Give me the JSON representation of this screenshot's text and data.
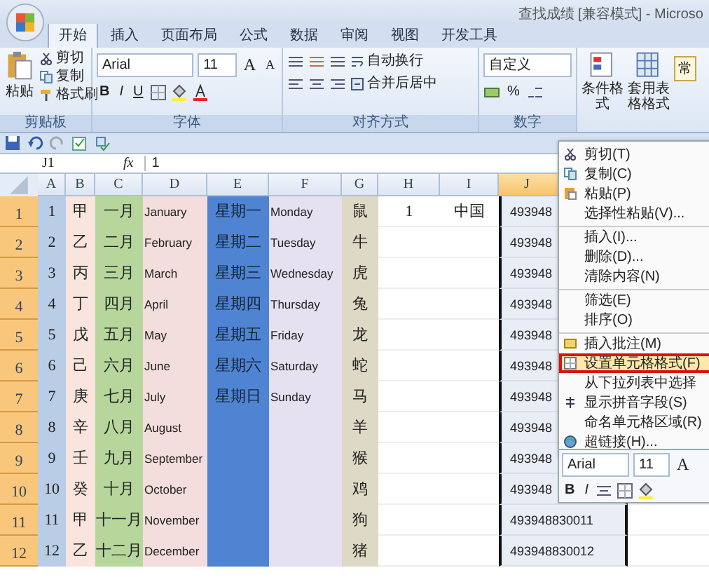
{
  "window": {
    "title": "查找成绩 [兼容模式] - Microso"
  },
  "ribbon_tabs": [
    {
      "label": "开始",
      "selected": true
    },
    {
      "label": "插入",
      "selected": false
    },
    {
      "label": "页面布局",
      "selected": false
    },
    {
      "label": "公式",
      "selected": false
    },
    {
      "label": "数据",
      "selected": false
    },
    {
      "label": "审阅",
      "selected": false
    },
    {
      "label": "视图",
      "selected": false
    },
    {
      "label": "开发工具",
      "selected": false
    }
  ],
  "clipboard": {
    "group": "剪贴板",
    "paste": "粘贴",
    "cut": "剪切",
    "copy": "复制",
    "format_painter": "格式刷"
  },
  "font": {
    "group": "字体",
    "family": "Arial",
    "size": "11",
    "grow": "A",
    "shrink": "A",
    "bold": "B",
    "italic": "I",
    "underline": "U"
  },
  "alignment": {
    "group": "对齐方式",
    "wrap": "自动换行",
    "merge": "合并后居中"
  },
  "number": {
    "group": "数字",
    "format": "自定义",
    "percent": "%"
  },
  "styles": {
    "conditional": "条件格式",
    "table": "套用表格格式",
    "cell_style": "常"
  },
  "formula_bar": {
    "name_box": "J1",
    "function_label": "fx",
    "value": "1"
  },
  "sheet": {
    "columns": [
      {
        "label": "A",
        "color": "#b9cde6",
        "selected": false
      },
      {
        "label": "B",
        "color": "#f9e5dd",
        "selected": false
      },
      {
        "label": "C",
        "color": "#b6d69c",
        "selected": false
      },
      {
        "label": "D",
        "color": "#f3dedd",
        "selected": false
      },
      {
        "label": "E",
        "color": "#4f84d2",
        "selected": false
      },
      {
        "label": "F",
        "color": "#e6e1f1",
        "selected": false
      },
      {
        "label": "G",
        "color": "#ddd9c4",
        "selected": false
      },
      {
        "label": "H",
        "color": "#ffffff",
        "selected": false
      },
      {
        "label": "I",
        "color": "#ffffff",
        "selected": false
      },
      {
        "label": "J",
        "color": "#e9edf5",
        "selected": true
      }
    ],
    "rows": [
      {
        "label": "1",
        "selected": true,
        "cells": [
          "1",
          "甲",
          "一月",
          "January",
          "星期一",
          "Monday",
          "鼠",
          "1",
          "中国",
          "493948"
        ]
      },
      {
        "label": "2",
        "selected": true,
        "cells": [
          "2",
          "乙",
          "二月",
          "February",
          "星期二",
          "Tuesday",
          "牛",
          null,
          null,
          "493948"
        ]
      },
      {
        "label": "3",
        "selected": true,
        "cells": [
          "3",
          "丙",
          "三月",
          "March",
          "星期三",
          "Wednesday",
          "虎",
          null,
          null,
          "493948"
        ]
      },
      {
        "label": "4",
        "selected": true,
        "cells": [
          "4",
          "丁",
          "四月",
          "April",
          "星期四",
          "Thursday",
          "兔",
          null,
          null,
          "493948"
        ]
      },
      {
        "label": "5",
        "selected": true,
        "cells": [
          "5",
          "戊",
          "五月",
          "May",
          "星期五",
          "Friday",
          "龙",
          null,
          null,
          "493948"
        ]
      },
      {
        "label": "6",
        "selected": true,
        "cells": [
          "6",
          "己",
          "六月",
          "June",
          "星期六",
          "Saturday",
          "蛇",
          null,
          null,
          "493948"
        ]
      },
      {
        "label": "7",
        "selected": true,
        "cells": [
          "7",
          "庚",
          "七月",
          "July",
          "星期日",
          "Sunday",
          "马",
          null,
          null,
          "493948"
        ]
      },
      {
        "label": "8",
        "selected": true,
        "cells": [
          "8",
          "辛",
          "八月",
          "August",
          null,
          null,
          "羊",
          null,
          null,
          "493948"
        ]
      },
      {
        "label": "9",
        "selected": true,
        "cells": [
          "9",
          "壬",
          "九月",
          "September",
          null,
          null,
          "猴",
          null,
          null,
          "493948"
        ]
      },
      {
        "label": "10",
        "selected": true,
        "cells": [
          "10",
          "癸",
          "十月",
          "October",
          null,
          null,
          "鸡",
          null,
          null,
          "493948"
        ]
      },
      {
        "label": "11",
        "selected": true,
        "cells": [
          "11",
          "甲",
          "十一月",
          "November",
          null,
          null,
          "狗",
          null,
          null,
          "493948830011"
        ]
      },
      {
        "label": "12",
        "selected": true,
        "cells": [
          "12",
          "乙",
          "十二月",
          "December",
          null,
          null,
          "猪",
          null,
          null,
          "493948830012"
        ]
      }
    ]
  },
  "context_menu": [
    {
      "label": "剪切(T)",
      "selected": false,
      "separator_before": false
    },
    {
      "label": "复制(C)",
      "selected": false,
      "separator_before": false
    },
    {
      "label": "粘贴(P)",
      "selected": false,
      "separator_before": false
    },
    {
      "label": "选择性粘贴(V)...",
      "selected": false,
      "separator_before": false
    },
    {
      "label": "插入(I)...",
      "selected": false,
      "separator_before": true
    },
    {
      "label": "删除(D)...",
      "selected": false,
      "separator_before": false
    },
    {
      "label": "清除内容(N)",
      "selected": false,
      "separator_before": false
    },
    {
      "label": "筛选(E)",
      "selected": false,
      "separator_before": true
    },
    {
      "label": "排序(O)",
      "selected": false,
      "separator_before": false
    },
    {
      "label": "插入批注(M)",
      "selected": false,
      "separator_before": true
    },
    {
      "label": "设置单元格格式(F)",
      "selected": true,
      "separator_before": false
    },
    {
      "label": "从下拉列表中选择",
      "selected": false,
      "separator_before": false
    },
    {
      "label": "显示拼音字段(S)",
      "selected": false,
      "separator_before": false
    },
    {
      "label": "命名单元格区域(R)",
      "selected": false,
      "separator_before": false
    },
    {
      "label": "超链接(H)...",
      "selected": false,
      "separator_before": false
    }
  ],
  "mini_toolbar": {
    "family": "Arial",
    "size": "11",
    "grow": "A",
    "bold": "B",
    "italic": "I"
  }
}
